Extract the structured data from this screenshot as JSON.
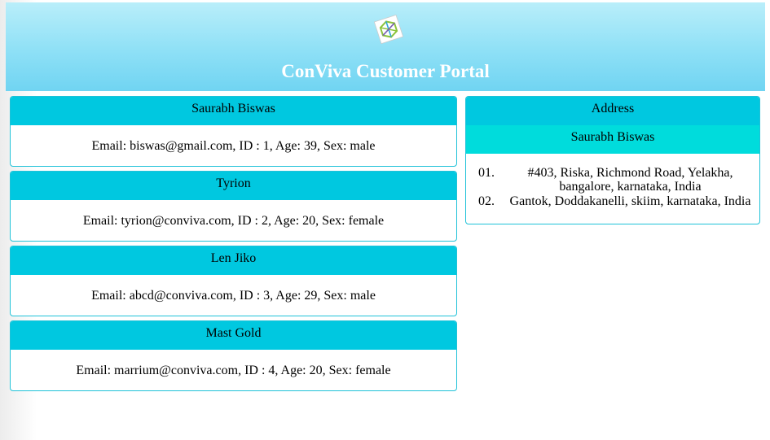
{
  "header": {
    "title": "ConViva Customer Portal",
    "logo_icon": "conviva-logo-icon",
    "gradient_colors": [
      "#b9eefa",
      "#70d4f2"
    ]
  },
  "theme": {
    "card_header": "#00c8e0",
    "address_subheader": "#00dcdc",
    "card_border": "#1fc2d8"
  },
  "customers": [
    {
      "name": "Saurabh Biswas",
      "details": "Email: biswas@gmail.com, ID : 1, Age: 39, Sex: male"
    },
    {
      "name": "Tyrion",
      "details": "Email: tyrion@conviva.com, ID : 2, Age: 20, Sex: female"
    },
    {
      "name": "Len Jiko",
      "details": "Email: abcd@conviva.com, ID : 3, Age: 29, Sex: male"
    },
    {
      "name": "Mast Gold",
      "details": "Email: marrium@conviva.com, ID : 4, Age: 20, Sex: female"
    }
  ],
  "address_panel": {
    "title": "Address",
    "customer_name": "Saurabh Biswas",
    "addresses": [
      {
        "num": "01.",
        "text": "#403, Riska, Richmond Road, Yelakha, bangalore, karnataka, India"
      },
      {
        "num": "02.",
        "text": "Gantok, Doddakanelli, skiim, karnataka, India"
      }
    ]
  }
}
